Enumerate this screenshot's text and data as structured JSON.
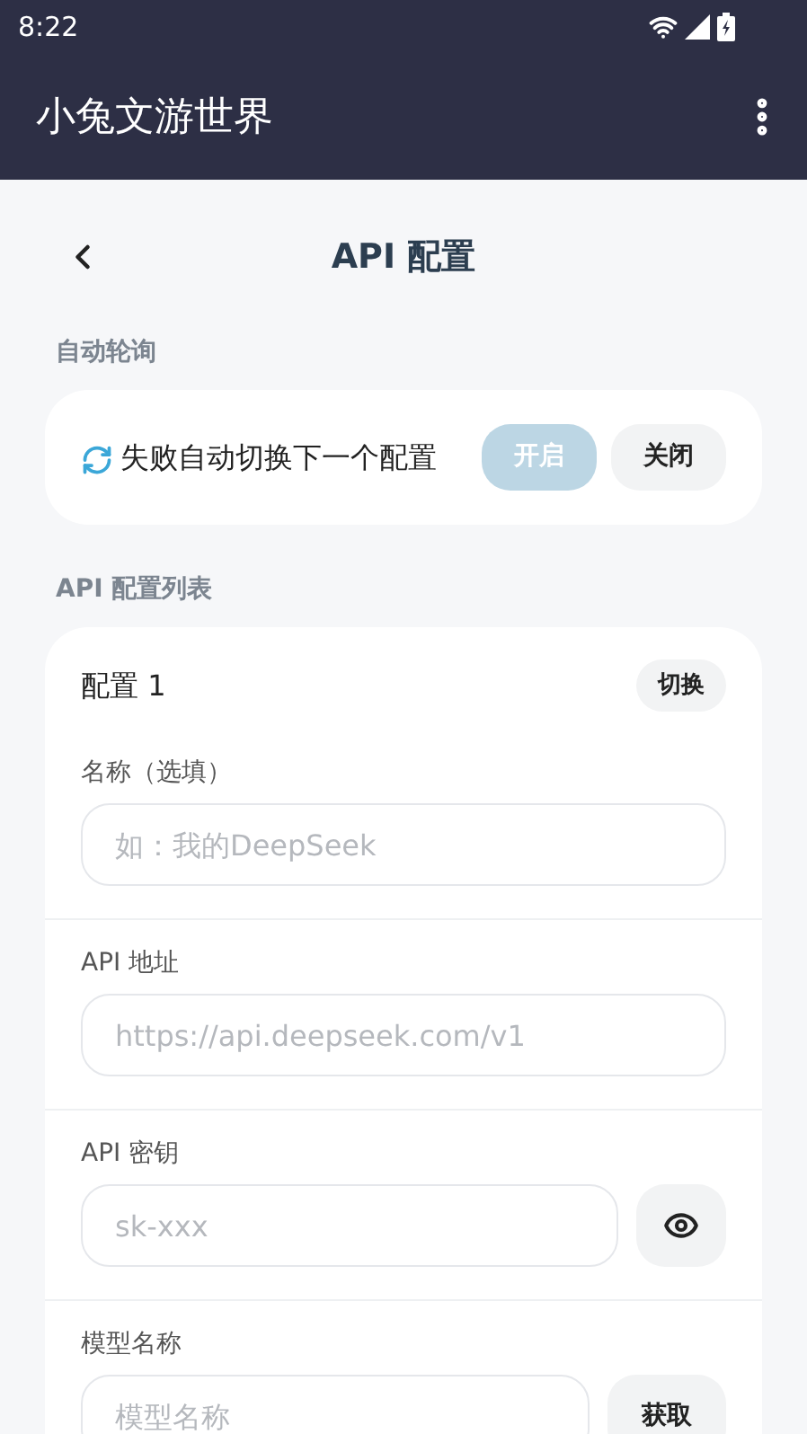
{
  "status_bar": {
    "time": "8:22"
  },
  "app_bar": {
    "title": "小兔文游世界"
  },
  "page": {
    "title": "API 配置"
  },
  "auto_poll": {
    "heading": "自动轮询",
    "label": "失败自动切换下一个配置",
    "options": [
      {
        "label": "开启",
        "selected": true
      },
      {
        "label": "关闭",
        "selected": false
      }
    ]
  },
  "config_list": {
    "heading": "API 配置列表",
    "configs": [
      {
        "name": "配置 1",
        "switch_button": "切换",
        "fields": [
          {
            "kind": "plain",
            "label": "名称（选填）",
            "placeholder": "如：我的DeepSeek"
          },
          {
            "kind": "plain",
            "label": "API 地址",
            "placeholder": "https://api.deepseek.com/v1"
          },
          {
            "kind": "secret",
            "label": "API 密钥",
            "placeholder": "sk-xxx"
          },
          {
            "kind": "fetch",
            "label": "模型名称",
            "placeholder": "模型名称",
            "button": "获取"
          }
        ]
      }
    ]
  }
}
